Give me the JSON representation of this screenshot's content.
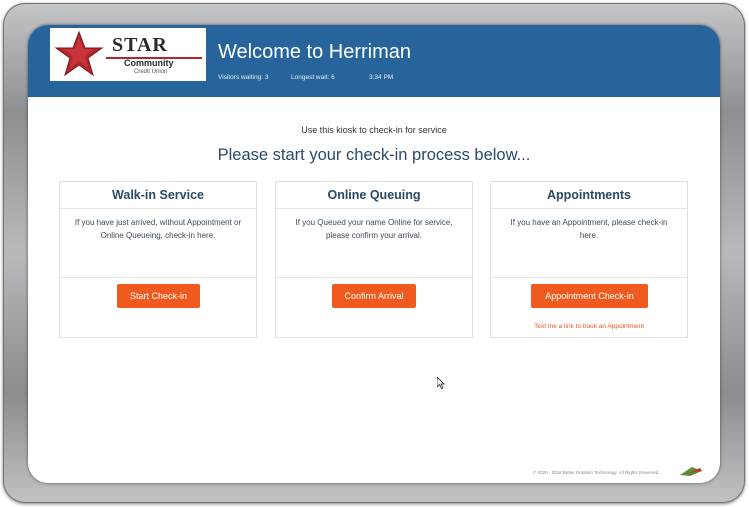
{
  "header": {
    "logo": {
      "name": "STAR",
      "line2": "Community",
      "line3": "Credit Union"
    },
    "title": "Welcome to Herriman",
    "stats": {
      "visitors": "Visitors waiting: 3",
      "longest_wait": "Longest wait: 6",
      "time": "3:34 PM"
    }
  },
  "main": {
    "intro": "Use this kiosk to check-in for service",
    "headline": "Please start your check-in process below...",
    "cards": [
      {
        "title": "Walk-in Service",
        "description": "If you have just arrived, without Appointment or Online Queueing, check-in here.",
        "button": "Start Check-in"
      },
      {
        "title": "Online Queuing",
        "description": "If you Queued your name Online for service, please confirm your arrival.",
        "button": "Confirm Arrival"
      },
      {
        "title": "Appointments",
        "description": "If you have an Appointment, please check-in here.",
        "button": "Appointment Check-in",
        "link": "Text me a link to book an Appointment"
      }
    ]
  },
  "footer": {
    "copyright": "© 2020 - 2018 Better Rotation Technology. All Rights Reserved."
  },
  "colors": {
    "header_bg": "#26649b",
    "button_bg": "#f05a1e",
    "title_text": "#2a4a68",
    "logo_red": "#b3262b"
  },
  "icons": {
    "logo": "star-icon",
    "cursor": "mouse-pointer-icon"
  }
}
